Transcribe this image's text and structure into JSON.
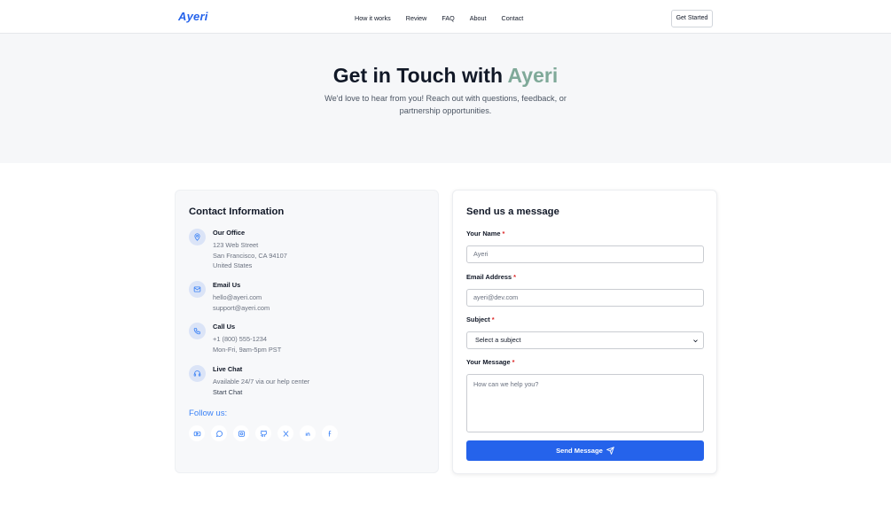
{
  "header": {
    "logo": "Ayeri",
    "nav": [
      "How it works",
      "Review",
      "FAQ",
      "About",
      "Contact"
    ],
    "cta": "Get Started"
  },
  "hero": {
    "title_main": "Get in Touch with ",
    "title_accent": "Ayeri",
    "subtitle": "We'd love to hear from you! Reach out with questions, feedback, or partnership opportunities."
  },
  "contact_info": {
    "title": "Contact Information",
    "office": {
      "title": "Our Office",
      "lines": [
        "123 Web Street",
        "San Francisco, CA 94107",
        "United States"
      ]
    },
    "email": {
      "title": "Email Us",
      "lines": [
        "hello@ayeri.com",
        "support@ayeri.com"
      ]
    },
    "call": {
      "title": "Call Us",
      "lines": [
        "+1 (800) 555-1234",
        "Mon-Fri, 9am-5pm PST"
      ]
    },
    "chat": {
      "title": "Live Chat",
      "lines": [
        "Available 24/7 via our help center",
        "Start Chat"
      ]
    },
    "follow_label": "Follow us:",
    "socials": [
      "youtube-icon",
      "whatsapp-icon",
      "instagram-icon",
      "github-icon",
      "x-icon",
      "linkedin-icon",
      "facebook-icon"
    ]
  },
  "form": {
    "title": "Send us a message",
    "name": {
      "label": "Your Name",
      "required": "*",
      "placeholder": "Ayeri"
    },
    "email": {
      "label": "Email Address",
      "required": "*",
      "placeholder": "ayeri@dev.com"
    },
    "subject": {
      "label": "Subject",
      "required": "*",
      "selected": "Select a subject"
    },
    "message": {
      "label": "Your Message",
      "required": "*",
      "placeholder": "How can we help you?"
    },
    "submit": "Send Message"
  },
  "colors": {
    "primary": "#2563eb",
    "accent": "#7fa999",
    "required": "#dc2626"
  }
}
